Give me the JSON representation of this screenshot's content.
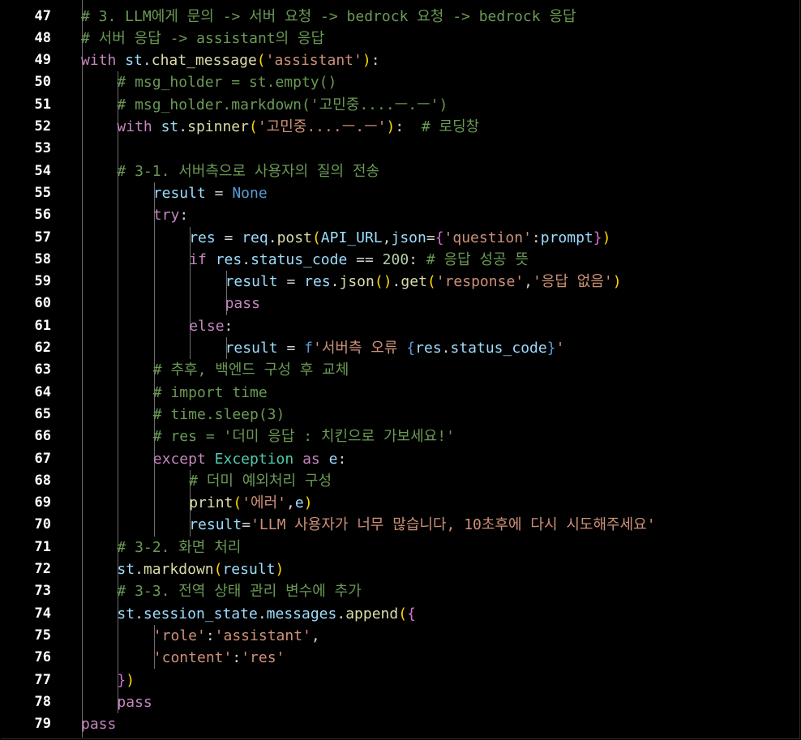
{
  "editor": {
    "language": "python",
    "colors": {
      "background": "#000000",
      "line_number": "#ffffff",
      "comment": "#6a9955",
      "keyword": "#c586c0",
      "variable": "#9cdcfe",
      "function": "#dcdcaa",
      "string": "#ce9178",
      "constant": "#569cd6",
      "number": "#b5cea8",
      "class": "#4ec9b0",
      "operator": "#d4d4d4",
      "bracket": "#ffd700",
      "bracket_alt": "#da70d6"
    },
    "lines": [
      {
        "num": "47",
        "indent": 1,
        "tokens": [
          {
            "t": "# 3. LLM에게 문의 -> 서버 요청 -> bedrock 요청 -> bedrock 응답",
            "c": "comment"
          }
        ]
      },
      {
        "num": "48",
        "indent": 1,
        "tokens": [
          {
            "t": "# 서버 응답 -> assistant의 응답",
            "c": "comment"
          }
        ]
      },
      {
        "num": "49",
        "indent": 1,
        "tokens": [
          {
            "t": "with",
            "c": "keyword"
          },
          {
            "t": " ",
            "c": "operator"
          },
          {
            "t": "st",
            "c": "variable"
          },
          {
            "t": ".",
            "c": "operator"
          },
          {
            "t": "chat_message",
            "c": "function"
          },
          {
            "t": "(",
            "c": "bracket"
          },
          {
            "t": "'assistant'",
            "c": "string"
          },
          {
            "t": ")",
            "c": "bracket"
          },
          {
            "t": ":",
            "c": "operator"
          }
        ]
      },
      {
        "num": "50",
        "indent": 2,
        "tokens": [
          {
            "t": "# msg_holder = st.empty()",
            "c": "comment"
          }
        ]
      },
      {
        "num": "51",
        "indent": 2,
        "tokens": [
          {
            "t": "# msg_holder.markdown('고민중....ㅡ.ㅡ')",
            "c": "comment"
          }
        ]
      },
      {
        "num": "52",
        "indent": 2,
        "tokens": [
          {
            "t": "with",
            "c": "keyword"
          },
          {
            "t": " ",
            "c": "operator"
          },
          {
            "t": "st",
            "c": "variable"
          },
          {
            "t": ".",
            "c": "operator"
          },
          {
            "t": "spinner",
            "c": "function"
          },
          {
            "t": "(",
            "c": "bracket"
          },
          {
            "t": "'고민중....ㅡ.ㅡ'",
            "c": "string"
          },
          {
            "t": ")",
            "c": "bracket"
          },
          {
            "t": ":  ",
            "c": "operator"
          },
          {
            "t": "# 로딩창",
            "c": "comment"
          }
        ]
      },
      {
        "num": "53",
        "indent": 2,
        "tokens": []
      },
      {
        "num": "54",
        "indent": 2,
        "tokens": [
          {
            "t": "# 3-1. 서버측으로 사용자의 질의 전송",
            "c": "comment"
          }
        ]
      },
      {
        "num": "55",
        "indent": 3,
        "tokens": [
          {
            "t": "result",
            "c": "variable"
          },
          {
            "t": " = ",
            "c": "operator"
          },
          {
            "t": "None",
            "c": "constant"
          }
        ]
      },
      {
        "num": "56",
        "indent": 3,
        "tokens": [
          {
            "t": "try",
            "c": "keyword"
          },
          {
            "t": ":",
            "c": "operator"
          }
        ]
      },
      {
        "num": "57",
        "indent": 4,
        "tokens": [
          {
            "t": "res",
            "c": "variable"
          },
          {
            "t": " = ",
            "c": "operator"
          },
          {
            "t": "req",
            "c": "variable"
          },
          {
            "t": ".",
            "c": "operator"
          },
          {
            "t": "post",
            "c": "function"
          },
          {
            "t": "(",
            "c": "bracket"
          },
          {
            "t": "API_URL",
            "c": "variable"
          },
          {
            "t": ",",
            "c": "operator"
          },
          {
            "t": "json",
            "c": "variable"
          },
          {
            "t": "=",
            "c": "operator"
          },
          {
            "t": "{",
            "c": "bracket_alt"
          },
          {
            "t": "'question'",
            "c": "string"
          },
          {
            "t": ":",
            "c": "operator"
          },
          {
            "t": "prompt",
            "c": "variable"
          },
          {
            "t": "}",
            "c": "bracket_alt"
          },
          {
            "t": ")",
            "c": "bracket"
          }
        ]
      },
      {
        "num": "58",
        "indent": 4,
        "tokens": [
          {
            "t": "if",
            "c": "keyword"
          },
          {
            "t": " ",
            "c": "operator"
          },
          {
            "t": "res",
            "c": "variable"
          },
          {
            "t": ".",
            "c": "operator"
          },
          {
            "t": "status_code",
            "c": "variable"
          },
          {
            "t": " == ",
            "c": "operator"
          },
          {
            "t": "200",
            "c": "number"
          },
          {
            "t": ": ",
            "c": "operator"
          },
          {
            "t": "# 응답 성공 뜻",
            "c": "comment"
          }
        ]
      },
      {
        "num": "59",
        "indent": 5,
        "tokens": [
          {
            "t": "result",
            "c": "variable"
          },
          {
            "t": " = ",
            "c": "operator"
          },
          {
            "t": "res",
            "c": "variable"
          },
          {
            "t": ".",
            "c": "operator"
          },
          {
            "t": "json",
            "c": "function"
          },
          {
            "t": "()",
            "c": "bracket"
          },
          {
            "t": ".",
            "c": "operator"
          },
          {
            "t": "get",
            "c": "function"
          },
          {
            "t": "(",
            "c": "bracket"
          },
          {
            "t": "'response'",
            "c": "string"
          },
          {
            "t": ",",
            "c": "operator"
          },
          {
            "t": "'응답 없음'",
            "c": "string"
          },
          {
            "t": ")",
            "c": "bracket"
          }
        ]
      },
      {
        "num": "60",
        "indent": 5,
        "tokens": [
          {
            "t": "pass",
            "c": "keyword"
          }
        ]
      },
      {
        "num": "61",
        "indent": 4,
        "tokens": [
          {
            "t": "else",
            "c": "keyword"
          },
          {
            "t": ":",
            "c": "operator"
          }
        ]
      },
      {
        "num": "62",
        "indent": 5,
        "tokens": [
          {
            "t": "result",
            "c": "variable"
          },
          {
            "t": " = ",
            "c": "operator"
          },
          {
            "t": "f",
            "c": "constant"
          },
          {
            "t": "'서버측 오류 ",
            "c": "string"
          },
          {
            "t": "{",
            "c": "constant"
          },
          {
            "t": "res",
            "c": "variable"
          },
          {
            "t": ".",
            "c": "operator"
          },
          {
            "t": "status_code",
            "c": "variable"
          },
          {
            "t": "}",
            "c": "constant"
          },
          {
            "t": "'",
            "c": "string"
          }
        ]
      },
      {
        "num": "63",
        "indent": 3,
        "tokens": [
          {
            "t": "# 추후, 백엔드 구성 후 교체",
            "c": "comment"
          }
        ]
      },
      {
        "num": "64",
        "indent": 3,
        "tokens": [
          {
            "t": "# import time",
            "c": "comment"
          }
        ]
      },
      {
        "num": "65",
        "indent": 3,
        "tokens": [
          {
            "t": "# time.sleep(3)",
            "c": "comment"
          }
        ]
      },
      {
        "num": "66",
        "indent": 3,
        "tokens": [
          {
            "t": "# res = '더미 응답 : 치킨으로 가보세요!'",
            "c": "comment"
          }
        ]
      },
      {
        "num": "67",
        "indent": 3,
        "tokens": [
          {
            "t": "except",
            "c": "keyword"
          },
          {
            "t": " ",
            "c": "operator"
          },
          {
            "t": "Exception",
            "c": "class"
          },
          {
            "t": " ",
            "c": "operator"
          },
          {
            "t": "as",
            "c": "keyword"
          },
          {
            "t": " ",
            "c": "operator"
          },
          {
            "t": "e",
            "c": "variable"
          },
          {
            "t": ":",
            "c": "operator"
          }
        ]
      },
      {
        "num": "68",
        "indent": 4,
        "tokens": [
          {
            "t": "# 더미 예외처리 구성",
            "c": "comment"
          }
        ]
      },
      {
        "num": "69",
        "indent": 4,
        "tokens": [
          {
            "t": "print",
            "c": "function"
          },
          {
            "t": "(",
            "c": "bracket"
          },
          {
            "t": "'에러'",
            "c": "string"
          },
          {
            "t": ",",
            "c": "operator"
          },
          {
            "t": "e",
            "c": "variable"
          },
          {
            "t": ")",
            "c": "bracket"
          }
        ]
      },
      {
        "num": "70",
        "indent": 4,
        "tokens": [
          {
            "t": "result",
            "c": "variable"
          },
          {
            "t": "=",
            "c": "operator"
          },
          {
            "t": "'LLM 사용자가 너무 많습니다, 10초후에 다시 시도해주세요'",
            "c": "string"
          }
        ]
      },
      {
        "num": "71",
        "indent": 2,
        "tokens": [
          {
            "t": "# 3-2. 화면 처리",
            "c": "comment"
          }
        ]
      },
      {
        "num": "72",
        "indent": 2,
        "tokens": [
          {
            "t": "st",
            "c": "variable"
          },
          {
            "t": ".",
            "c": "operator"
          },
          {
            "t": "markdown",
            "c": "function"
          },
          {
            "t": "(",
            "c": "bracket"
          },
          {
            "t": "result",
            "c": "variable"
          },
          {
            "t": ")",
            "c": "bracket"
          }
        ]
      },
      {
        "num": "73",
        "indent": 2,
        "tokens": [
          {
            "t": "# 3-3. 전역 상태 관리 변수에 추가",
            "c": "comment"
          }
        ]
      },
      {
        "num": "74",
        "indent": 2,
        "tokens": [
          {
            "t": "st",
            "c": "variable"
          },
          {
            "t": ".",
            "c": "operator"
          },
          {
            "t": "session_state",
            "c": "variable"
          },
          {
            "t": ".",
            "c": "operator"
          },
          {
            "t": "messages",
            "c": "variable"
          },
          {
            "t": ".",
            "c": "operator"
          },
          {
            "t": "append",
            "c": "function"
          },
          {
            "t": "(",
            "c": "bracket"
          },
          {
            "t": "{",
            "c": "bracket_alt"
          }
        ]
      },
      {
        "num": "75",
        "indent": 3,
        "tokens": [
          {
            "t": "'role'",
            "c": "string"
          },
          {
            "t": ":",
            "c": "operator"
          },
          {
            "t": "'assistant'",
            "c": "string"
          },
          {
            "t": ",",
            "c": "operator"
          }
        ]
      },
      {
        "num": "76",
        "indent": 3,
        "tokens": [
          {
            "t": "'content'",
            "c": "string"
          },
          {
            "t": ":",
            "c": "operator"
          },
          {
            "t": "'res'",
            "c": "string"
          }
        ]
      },
      {
        "num": "77",
        "indent": 2,
        "tokens": [
          {
            "t": "}",
            "c": "bracket_alt"
          },
          {
            "t": ")",
            "c": "bracket"
          }
        ]
      },
      {
        "num": "78",
        "indent": 2,
        "tokens": [
          {
            "t": "pass",
            "c": "keyword"
          }
        ]
      },
      {
        "num": "79",
        "indent": 1,
        "tokens": [
          {
            "t": "pass",
            "c": "keyword"
          }
        ]
      }
    ],
    "indent_guides": [
      {
        "level": 1,
        "from": "50",
        "to": "78"
      },
      {
        "level": 2,
        "from": "55",
        "to": "70"
      },
      {
        "level": 2,
        "from": "75",
        "to": "76"
      },
      {
        "level": 3,
        "from": "57",
        "to": "62"
      },
      {
        "level": 3,
        "from": "68",
        "to": "70"
      },
      {
        "level": 4,
        "from": "59",
        "to": "60"
      },
      {
        "level": 4,
        "from": "62",
        "to": "62"
      }
    ]
  }
}
